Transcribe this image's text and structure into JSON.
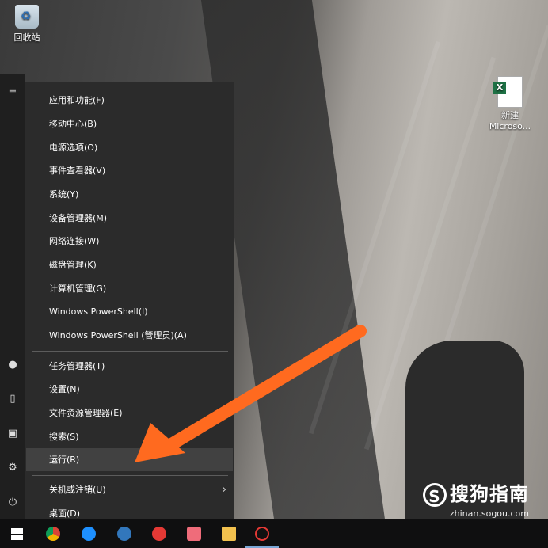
{
  "desktop": {
    "icons": [
      {
        "label": "回收站"
      },
      {
        "label": "新建 Microso..."
      }
    ]
  },
  "start_rail": {
    "icons": [
      "hamburger-icon",
      "user-icon",
      "document-icon",
      "pictures-icon",
      "settings-icon",
      "power-icon"
    ]
  },
  "context_menu": {
    "group1": [
      "应用和功能(F)",
      "移动中心(B)",
      "电源选项(O)",
      "事件查看器(V)",
      "系统(Y)",
      "设备管理器(M)",
      "网络连接(W)",
      "磁盘管理(K)",
      "计算机管理(G)",
      "Windows PowerShell(I)",
      "Windows PowerShell (管理员)(A)"
    ],
    "group2": [
      "任务管理器(T)",
      "设置(N)",
      "文件资源管理器(E)",
      "搜索(S)",
      "运行(R)"
    ],
    "group3": [
      "关机或注销(U)",
      "桌面(D)"
    ],
    "highlighted": "运行(R)",
    "arrow_color": "#ff6a1f"
  },
  "taskbar": {
    "icons": [
      "windows-logo-icon",
      "chrome-icon",
      "ie-icon",
      "edge-icon",
      "qq-icon",
      "gift-icon",
      "explorer-icon",
      "qq-penguin-icon"
    ]
  },
  "watermark": {
    "brand": "搜狗指南",
    "url": "zhinan.sogou.com"
  }
}
